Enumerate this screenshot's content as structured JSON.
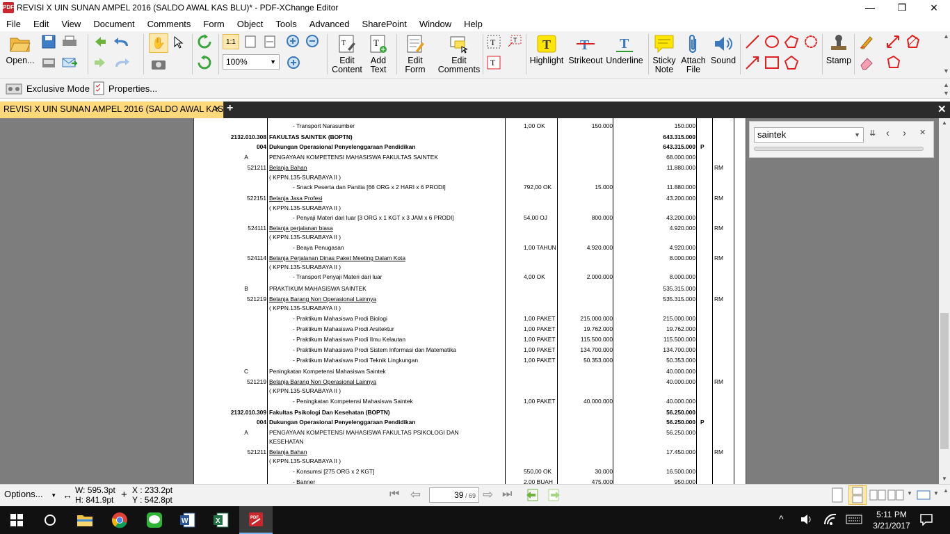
{
  "titlebar": {
    "title": "REVISI X UIN SUNAN AMPEL 2016 (SALDO AWAL KAS BLU)* - PDF-XChange Editor",
    "minimize": "—",
    "restore": "❐",
    "close": "✕",
    "app_icon": "PDF"
  },
  "menu": [
    "File",
    "Edit",
    "View",
    "Document",
    "Comments",
    "Form",
    "Object",
    "Tools",
    "Advanced",
    "SharePoint",
    "Window",
    "Help"
  ],
  "toolbar": {
    "open": "Open...",
    "zoom": "100%",
    "edit_content": [
      "Edit",
      "Content"
    ],
    "add_text": [
      "Add",
      "Text"
    ],
    "edit_form": [
      "Edit",
      "Form"
    ],
    "edit_comments": [
      "Edit",
      "Comments"
    ],
    "highlight": "Highlight",
    "strikeout": "Strikeout",
    "underline": "Underline",
    "sticky_note": [
      "Sticky",
      "Note"
    ],
    "attach_file": [
      "Attach",
      "File"
    ],
    "sound": "Sound",
    "stamp": "Stamp"
  },
  "toolbar2": {
    "exclusive_mode": "Exclusive Mode",
    "properties": "Properties..."
  },
  "tab": {
    "label": "REVISI X UIN SUNAN AMPEL 2016 (SALDO AWAL KAS .*",
    "close": "✕",
    "new": "+"
  },
  "search": {
    "value": "saintek"
  },
  "document_rows": [
    {
      "code": "",
      "text": "-      Transport Narasumber",
      "qty": "1,00 OK",
      "price": "150.000",
      "total": "150.000",
      "flag": "",
      "src": "",
      "bold": false,
      "ul": false,
      "indent": "item"
    },
    {
      "code": "2132.010.308",
      "text": "FAKULTAS SAINTEK  (BOPTN)",
      "qty": "",
      "price": "",
      "total": "643.315.000",
      "flag": "",
      "src": "",
      "bold": true,
      "ul": false,
      "indent": "none"
    },
    {
      "code": "004",
      "text": "Dukungan Operasional Penyelenggaraan Pendidikan",
      "qty": "",
      "price": "",
      "total": "643.315.000",
      "flag": "P",
      "src": "",
      "bold": true,
      "ul": false,
      "indent": "none"
    },
    {
      "code": "A",
      "text": "PENGAYAAN KOMPETENSI MAHASISWA FAKULTAS SAINTEK",
      "qty": "",
      "price": "",
      "total": "68.000.000",
      "flag": "",
      "src": "",
      "bold": false,
      "ul": false,
      "indent": "none"
    },
    {
      "code": "521211",
      "text": "Belanja Bahan",
      "qty": "",
      "price": "",
      "total": "11.880.000",
      "flag": "",
      "src": "RM",
      "bold": false,
      "ul": true,
      "indent": "none"
    },
    {
      "code": "",
      "text": "( KPPN.135-SURABAYA II  )",
      "qty": "",
      "price": "",
      "total": "",
      "flag": "",
      "src": "",
      "bold": false,
      "ul": false,
      "indent": "none"
    },
    {
      "code": "",
      "text": "-      Snack  Peserta dan Panitia  [66 ORG x 2 HARI x 6 PRODI]",
      "qty": "792,00 OK",
      "price": "15.000",
      "total": "11.880.000",
      "flag": "",
      "src": "",
      "bold": false,
      "ul": false,
      "indent": "item"
    },
    {
      "code": "522151",
      "text": "Belanja Jasa Profesi",
      "qty": "",
      "price": "",
      "total": "43.200.000",
      "flag": "",
      "src": "RM",
      "bold": false,
      "ul": true,
      "indent": "none"
    },
    {
      "code": "",
      "text": "( KPPN.135-SURABAYA II  )",
      "qty": "",
      "price": "",
      "total": "",
      "flag": "",
      "src": "",
      "bold": false,
      "ul": false,
      "indent": "none"
    },
    {
      "code": "",
      "text": "-      Penyaji Materi dari luar  [3 ORG x 1 KGT x 3 JAM x 6 PRODI]",
      "qty": "54,00 OJ",
      "price": "800.000",
      "total": "43.200.000",
      "flag": "",
      "src": "",
      "bold": false,
      "ul": false,
      "indent": "item"
    },
    {
      "code": "524111",
      "text": "Belanja perjalanan biasa",
      "qty": "",
      "price": "",
      "total": "4.920.000",
      "flag": "",
      "src": "RM",
      "bold": false,
      "ul": true,
      "indent": "none"
    },
    {
      "code": "",
      "text": "( KPPN.135-SURABAYA II  )",
      "qty": "",
      "price": "",
      "total": "",
      "flag": "",
      "src": "",
      "bold": false,
      "ul": false,
      "indent": "none"
    },
    {
      "code": "",
      "text": "-      Beaya Penugasan",
      "qty": "1,00 TAHUN",
      "price": "4.920.000",
      "total": "4.920.000",
      "flag": "",
      "src": "",
      "bold": false,
      "ul": false,
      "indent": "item"
    },
    {
      "code": "524114",
      "text": "Belanja Perjalanan Dinas Paket Meeting Dalam Kota",
      "qty": "",
      "price": "",
      "total": "8.000.000",
      "flag": "",
      "src": "RM",
      "bold": false,
      "ul": true,
      "indent": "none"
    },
    {
      "code": "",
      "text": "( KPPN.135-SURABAYA II  )",
      "qty": "",
      "price": "",
      "total": "",
      "flag": "",
      "src": "",
      "bold": false,
      "ul": false,
      "indent": "none"
    },
    {
      "code": "",
      "text": "-      Transport Penyaji Materi dari luar",
      "qty": "4,00 OK",
      "price": "2.000.000",
      "total": "8.000.000",
      "flag": "",
      "src": "",
      "bold": false,
      "ul": false,
      "indent": "item"
    },
    {
      "code": "B",
      "text": "PRAKTIKUM MAHASISWA SAINTEK",
      "qty": "",
      "price": "",
      "total": "535.315.000",
      "flag": "",
      "src": "",
      "bold": false,
      "ul": false,
      "indent": "none"
    },
    {
      "code": "521219",
      "text": "Belanja Barang Non Operasional Lainnya",
      "qty": "",
      "price": "",
      "total": "535.315.000",
      "flag": "",
      "src": "RM",
      "bold": false,
      "ul": true,
      "indent": "none"
    },
    {
      "code": "",
      "text": "( KPPN.135-SURABAYA II  )",
      "qty": "",
      "price": "",
      "total": "",
      "flag": "",
      "src": "",
      "bold": false,
      "ul": false,
      "indent": "none"
    },
    {
      "code": "",
      "text": "-      Praktikum Mahasiswa Prodi Biologi",
      "qty": "1,00 PAKET",
      "price": "215.000.000",
      "total": "215.000.000",
      "flag": "",
      "src": "",
      "bold": false,
      "ul": false,
      "indent": "item"
    },
    {
      "code": "",
      "text": "-      Praktikum Mahasiswa Prodi Arsitektur",
      "qty": "1,00 PAKET",
      "price": "19.762.000",
      "total": "19.762.000",
      "flag": "",
      "src": "",
      "bold": false,
      "ul": false,
      "indent": "item"
    },
    {
      "code": "",
      "text": "-      Praktikum Mahasiswa Prodi Ilmu Kelautan",
      "qty": "1,00 PAKET",
      "price": "115.500.000",
      "total": "115.500.000",
      "flag": "",
      "src": "",
      "bold": false,
      "ul": false,
      "indent": "item"
    },
    {
      "code": "",
      "text": "-      Praktikum Mahasiswa Prodi Sistem Informasi  dan Matematika",
      "qty": "1,00 PAKET",
      "price": "134.700.000",
      "total": "134.700.000",
      "flag": "",
      "src": "",
      "bold": false,
      "ul": false,
      "indent": "item"
    },
    {
      "code": "",
      "text": "-      Praktikum Mahasiswa Prodi Teknik Lingkungan",
      "qty": "1,00 PAKET",
      "price": "50.353.000",
      "total": "50.353.000",
      "flag": "",
      "src": "",
      "bold": false,
      "ul": false,
      "indent": "item"
    },
    {
      "code": "C",
      "text": "Peningkatan Kompetensi Mahasiswa Saintek",
      "qty": "",
      "price": "",
      "total": "40.000.000",
      "flag": "",
      "src": "",
      "bold": false,
      "ul": false,
      "indent": "none"
    },
    {
      "code": "521219",
      "text": "Belanja Barang Non Operasional Lainnya",
      "qty": "",
      "price": "",
      "total": "40.000.000",
      "flag": "",
      "src": "RM",
      "bold": false,
      "ul": true,
      "indent": "none"
    },
    {
      "code": "",
      "text": "( KPPN.135-SURABAYA II  )",
      "qty": "",
      "price": "",
      "total": "",
      "flag": "",
      "src": "",
      "bold": false,
      "ul": false,
      "indent": "none"
    },
    {
      "code": "",
      "text": "-      Peningkatan Kompetensi Mahasiswa Saintek",
      "qty": "1,00 PAKET",
      "price": "40.000.000",
      "total": "40.000.000",
      "flag": "",
      "src": "",
      "bold": false,
      "ul": false,
      "indent": "item"
    },
    {
      "code": "2132.010.309",
      "text": "Fakultas Psikologi Dan Kesehatan (BOPTN)",
      "qty": "",
      "price": "",
      "total": "56.250.000",
      "flag": "",
      "src": "",
      "bold": true,
      "ul": false,
      "indent": "none"
    },
    {
      "code": "004",
      "text": "Dukungan Operasional Penyelenggaraan Pendidikan",
      "qty": "",
      "price": "",
      "total": "56.250.000",
      "flag": "P",
      "src": "",
      "bold": true,
      "ul": false,
      "indent": "none"
    },
    {
      "code": "A",
      "text": "PENGAYAAN KOMPETENSI MAHASISWA FAKULTAS PSIKOLOGI DAN",
      "qty": "",
      "price": "",
      "total": "56.250.000",
      "flag": "",
      "src": "",
      "bold": false,
      "ul": false,
      "indent": "none"
    },
    {
      "code": "",
      "text": "KESEHATAN",
      "qty": "",
      "price": "",
      "total": "",
      "flag": "",
      "src": "",
      "bold": false,
      "ul": false,
      "indent": "none"
    },
    {
      "code": "521211",
      "text": "Belanja Bahan",
      "qty": "",
      "price": "",
      "total": "17.450.000",
      "flag": "",
      "src": "RM",
      "bold": false,
      "ul": true,
      "indent": "none"
    },
    {
      "code": "",
      "text": "( KPPN.135-SURABAYA II  )",
      "qty": "",
      "price": "",
      "total": "",
      "flag": "",
      "src": "",
      "bold": false,
      "ul": false,
      "indent": "none"
    },
    {
      "code": "",
      "text": "-      Konsumsi  [275 ORG x 2 KGT]",
      "qty": "550,00 OK",
      "price": "30.000",
      "total": "16.500.000",
      "flag": "",
      "src": "",
      "bold": false,
      "ul": false,
      "indent": "item"
    },
    {
      "code": "",
      "text": "-      Banner",
      "qty": "2,00 BUAH",
      "price": "475.000",
      "total": "950.000",
      "flag": "",
      "src": "",
      "bold": false,
      "ul": false,
      "indent": "item"
    }
  ],
  "statusbar": {
    "options": "Options...",
    "width": "W: 595.3pt",
    "height": "H: 841.9pt",
    "x": "X : 233.2pt",
    "y": "Y : 542.8pt",
    "page_current": "39",
    "page_total": "69"
  },
  "taskbar": {
    "time": "5:11 PM",
    "date": "3/21/2017"
  },
  "colors": {
    "tab_active": "#fdd97a",
    "viewer_bg": "#7d7d7d",
    "taskbar_bg": "#111111",
    "pdf_red": "#c8282d"
  }
}
